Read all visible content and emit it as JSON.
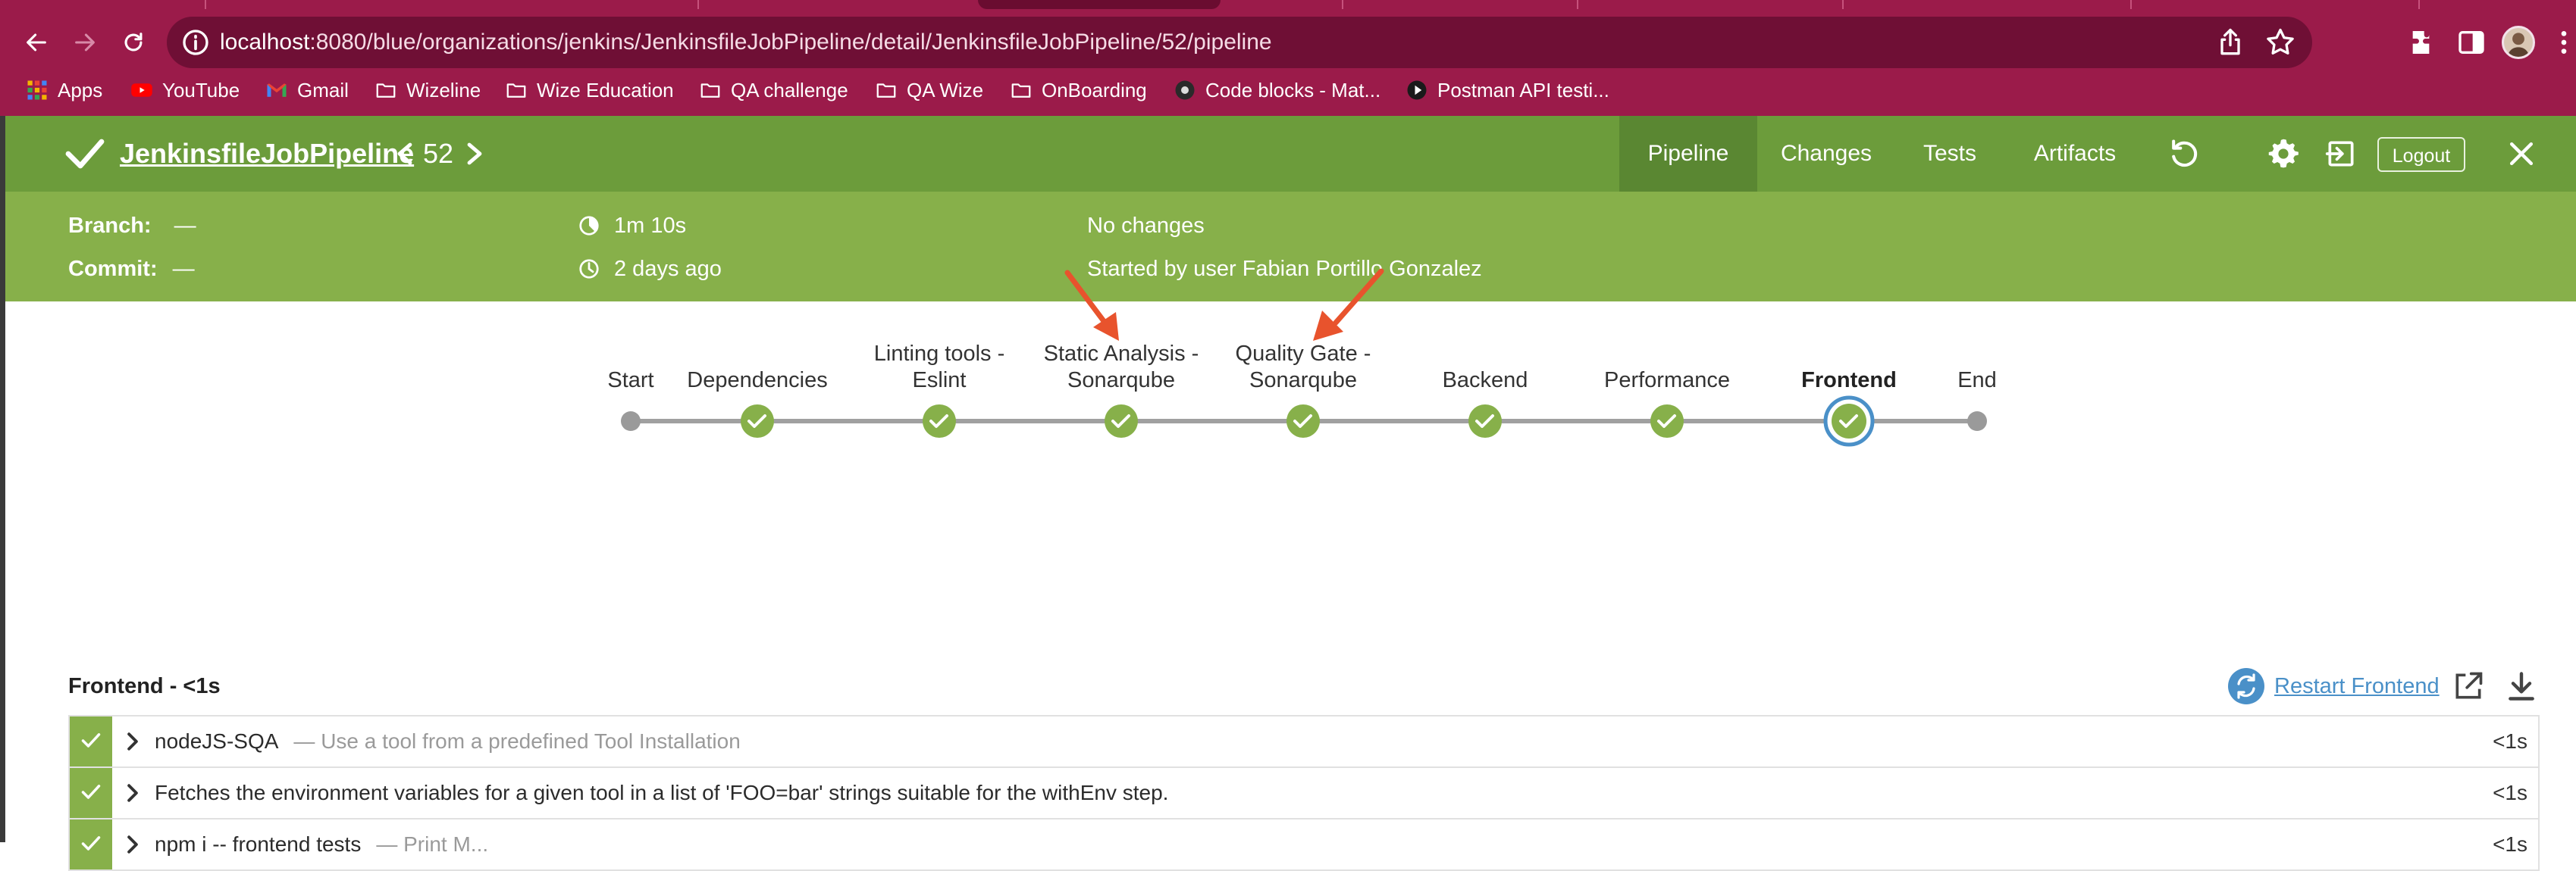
{
  "browser": {
    "url_host": "localhost",
    "url_rest": ":8080/blue/organizations/jenkins/JenkinsfileJobPipeline/detail/JenkinsfileJobPipeline/52/pipeline",
    "bookmarks": [
      {
        "label": "Apps",
        "icon": "apps-grid-icon"
      },
      {
        "label": "YouTube",
        "icon": "youtube-icon"
      },
      {
        "label": "Gmail",
        "icon": "gmail-icon"
      },
      {
        "label": "Wizeline",
        "icon": "folder-icon"
      },
      {
        "label": "Wize Education",
        "icon": "folder-icon"
      },
      {
        "label": "QA challenge",
        "icon": "folder-icon"
      },
      {
        "label": "QA Wize",
        "icon": "folder-icon"
      },
      {
        "label": "OnBoarding",
        "icon": "folder-icon"
      },
      {
        "label": "Code blocks - Mat...",
        "icon": "site-icon"
      },
      {
        "label": "Postman API testi...",
        "icon": "play-icon"
      }
    ]
  },
  "header": {
    "job_name": "JenkinsfileJobPipeline",
    "run_number": "52",
    "tabs": [
      "Pipeline",
      "Changes",
      "Tests",
      "Artifacts"
    ],
    "active_tab": "Pipeline",
    "logout_label": "Logout"
  },
  "summary": {
    "branch_label": "Branch:",
    "branch_value": "—",
    "commit_label": "Commit:",
    "commit_value": "—",
    "duration": "1m 10s",
    "when": "2 days ago",
    "changes": "No changes",
    "started_by": "Started by user Fabian Portillo Gonzalez"
  },
  "stages": [
    {
      "line1": "",
      "line2": "Start",
      "kind": "start"
    },
    {
      "line1": "",
      "line2": "Dependencies",
      "kind": "success"
    },
    {
      "line1": "Linting tools -",
      "line2": "Eslint",
      "kind": "success"
    },
    {
      "line1": "Static Analysis -",
      "line2": "Sonarqube",
      "kind": "success"
    },
    {
      "line1": "Quality Gate -",
      "line2": "Sonarqube",
      "kind": "success"
    },
    {
      "line1": "",
      "line2": "Backend",
      "kind": "success"
    },
    {
      "line1": "",
      "line2": "Performance",
      "kind": "success"
    },
    {
      "line1": "",
      "line2": "Frontend",
      "kind": "selected"
    },
    {
      "line1": "",
      "line2": "End",
      "kind": "end"
    }
  ],
  "colors": {
    "success": "#87b04a",
    "selected_ring": "#4a90c8",
    "annotation_arrow": "#e8532d",
    "chrome": "#9b1b4a"
  },
  "steps_panel": {
    "title": "Frontend - <1s",
    "restart_label": "Restart Frontend",
    "steps": [
      {
        "name": "nodeJS-SQA",
        "desc": "— Use a tool from a predefined Tool Installation",
        "duration": "<1s"
      },
      {
        "name": "Fetches the environment variables for a given tool in a list of 'FOO=bar' strings suitable for the withEnv step.",
        "desc": "",
        "duration": "<1s"
      },
      {
        "name": "npm i -- frontend tests",
        "desc": "— Print M...",
        "duration": "<1s"
      }
    ]
  }
}
